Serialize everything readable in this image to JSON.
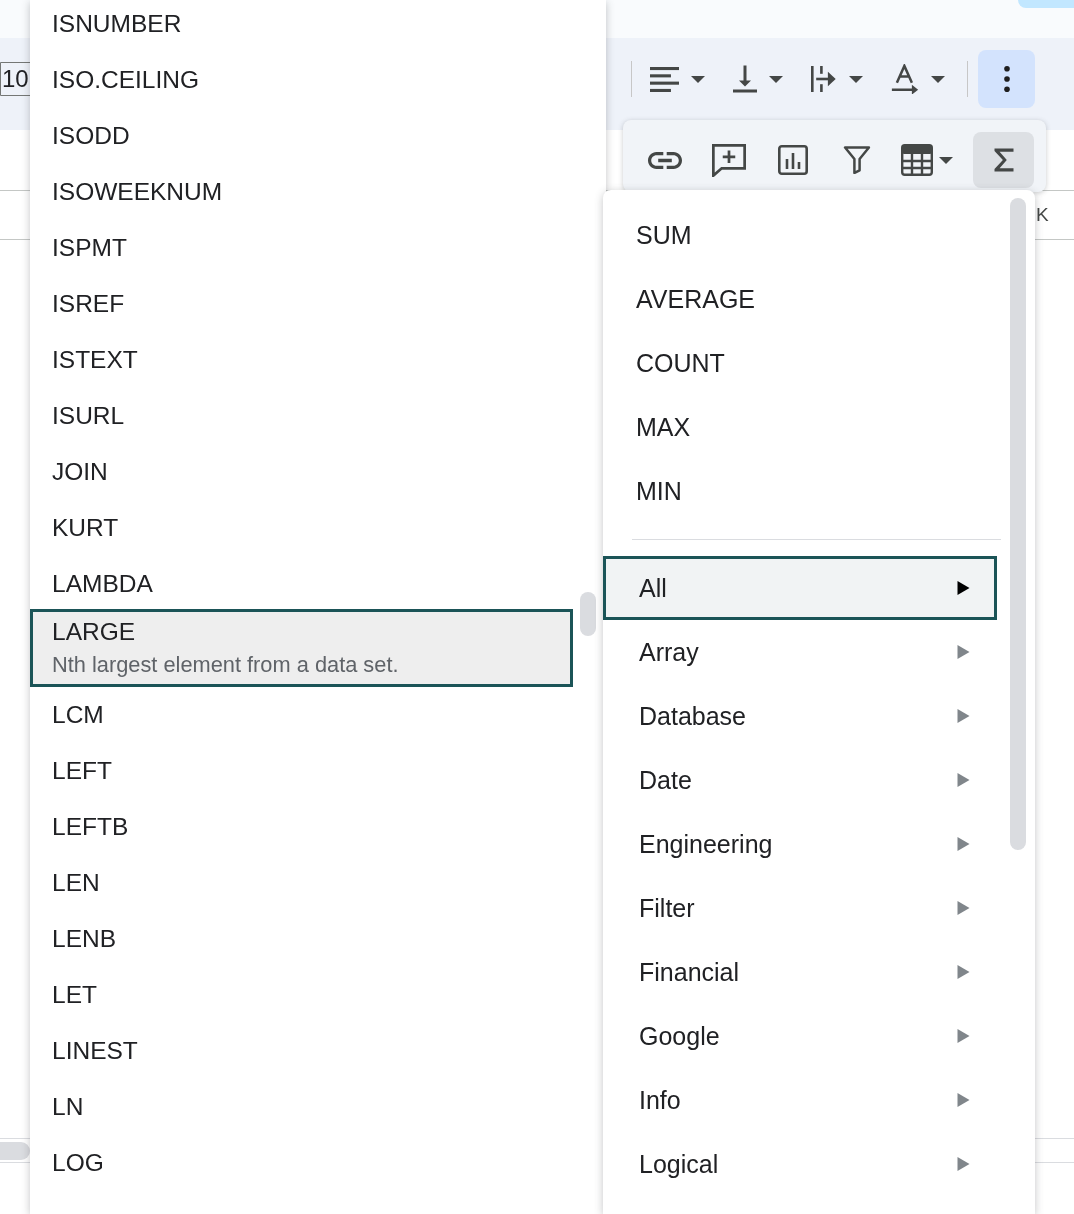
{
  "toolbar": {
    "font_size": "10",
    "tools": [
      {
        "kind": "align",
        "dropdown": true,
        "selected": false
      },
      {
        "kind": "vertical_align",
        "dropdown": true,
        "selected": false
      },
      {
        "kind": "wrap",
        "dropdown": true,
        "selected": false
      },
      {
        "kind": "rotate",
        "dropdown": true,
        "selected": false
      },
      {
        "kind": "more",
        "dropdown": false,
        "selected": true
      }
    ]
  },
  "more_toolbar": {
    "tools": [
      {
        "kind": "link",
        "dropdown": false,
        "selected": false
      },
      {
        "kind": "comment",
        "dropdown": false,
        "selected": false
      },
      {
        "kind": "chart",
        "dropdown": false,
        "selected": false
      },
      {
        "kind": "filter",
        "dropdown": false,
        "selected": false
      },
      {
        "kind": "functions_table",
        "dropdown": true,
        "selected": false
      },
      {
        "kind": "sigma",
        "dropdown": false,
        "selected": true
      }
    ]
  },
  "sheet": {
    "column_headers": [
      "K"
    ]
  },
  "function_list": {
    "items": [
      {
        "name": "ISNUMBER",
        "selected": false
      },
      {
        "name": "ISO.CEILING",
        "selected": false
      },
      {
        "name": "ISODD",
        "selected": false
      },
      {
        "name": "ISOWEEKNUM",
        "selected": false
      },
      {
        "name": "ISPMT",
        "selected": false
      },
      {
        "name": "ISREF",
        "selected": false
      },
      {
        "name": "ISTEXT",
        "selected": false
      },
      {
        "name": "ISURL",
        "selected": false
      },
      {
        "name": "JOIN",
        "selected": false
      },
      {
        "name": "KURT",
        "selected": false
      },
      {
        "name": "LAMBDA",
        "selected": false
      },
      {
        "name": "LARGE",
        "selected": true,
        "description": "Nth largest element from a data set."
      },
      {
        "name": "LCM",
        "selected": false
      },
      {
        "name": "LEFT",
        "selected": false
      },
      {
        "name": "LEFTB",
        "selected": false
      },
      {
        "name": "LEN",
        "selected": false
      },
      {
        "name": "LENB",
        "selected": false
      },
      {
        "name": "LET",
        "selected": false
      },
      {
        "name": "LINEST",
        "selected": false
      },
      {
        "name": "LN",
        "selected": false
      },
      {
        "name": "LOG",
        "selected": false
      }
    ]
  },
  "function_menu": {
    "quick": [
      "SUM",
      "AVERAGE",
      "COUNT",
      "MAX",
      "MIN"
    ],
    "categories": [
      {
        "label": "All",
        "selected": true
      },
      {
        "label": "Array",
        "selected": false
      },
      {
        "label": "Database",
        "selected": false
      },
      {
        "label": "Date",
        "selected": false
      },
      {
        "label": "Engineering",
        "selected": false
      },
      {
        "label": "Filter",
        "selected": false
      },
      {
        "label": "Financial",
        "selected": false
      },
      {
        "label": "Google",
        "selected": false
      },
      {
        "label": "Info",
        "selected": false
      },
      {
        "label": "Logical",
        "selected": false
      }
    ]
  }
}
